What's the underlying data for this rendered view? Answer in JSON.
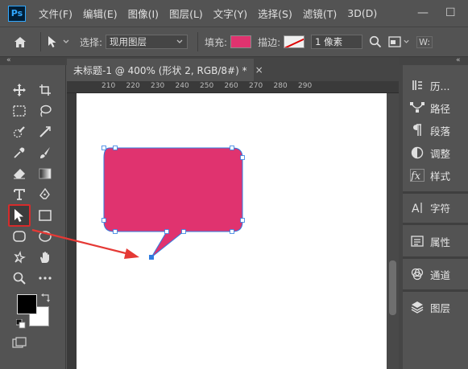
{
  "app": {
    "logo": "Ps",
    "menu": [
      "文件(F)",
      "编辑(E)",
      "图像(I)",
      "图层(L)",
      "文字(Y)",
      "选择(S)",
      "滤镜(T)",
      "3D(D)"
    ]
  },
  "window_controls": {
    "minimize": "—",
    "maximize": "☐"
  },
  "options": {
    "select_label": "选择:",
    "select_value": "现用图层",
    "fill_label": "填充:",
    "fill_color": "#e0336f",
    "stroke_label": "描边:",
    "stroke_width": "1 像素",
    "w_label": "W:"
  },
  "document": {
    "tab_title": "未标题-1 @ 400% (形状 2, RGB/8#) *",
    "close": "×",
    "ruler_ticks": [
      "210",
      "220",
      "230",
      "240",
      "250",
      "260",
      "270",
      "280",
      "290"
    ]
  },
  "shape": {
    "fill_color": "#e0336f",
    "path_color": "#2f7de1",
    "arrow_color": "#e53935"
  },
  "colors": {
    "foreground": "#000000",
    "background": "#ffffff"
  },
  "dock": [
    {
      "icon": "history-icon",
      "label": "历..."
    },
    {
      "icon": "paths-icon",
      "label": "路径"
    },
    {
      "icon": "paragraph-icon",
      "label": "段落"
    },
    {
      "icon": "adjustments-icon",
      "label": "调整"
    },
    {
      "icon": "styles-icon",
      "label": "样式"
    },
    {
      "icon": "character-icon",
      "label": "字符"
    },
    {
      "icon": "properties-icon",
      "label": "属性"
    },
    {
      "icon": "channels-icon",
      "label": "通道"
    },
    {
      "icon": "layers-icon",
      "label": "图层"
    }
  ]
}
